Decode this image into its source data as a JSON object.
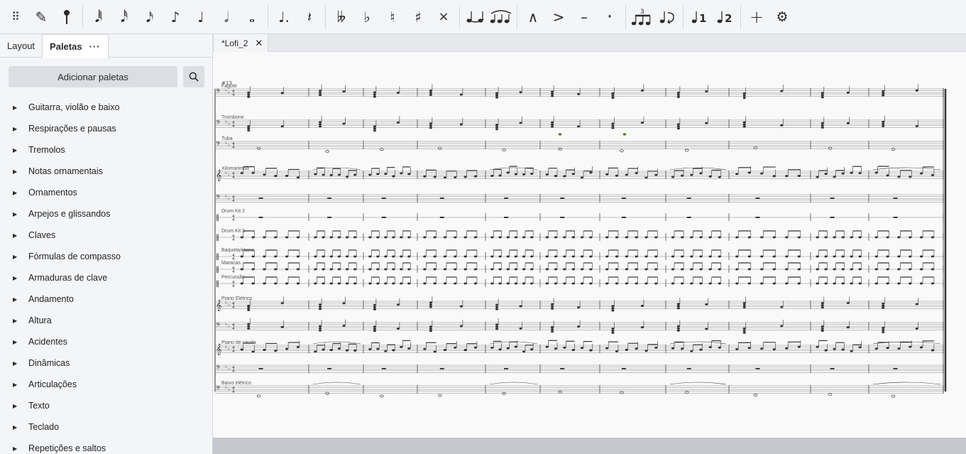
{
  "toolbar": {
    "items": [
      {
        "name": "drag-handle-icon",
        "glyph": "⠿"
      },
      {
        "name": "pencil-icon",
        "glyph": "✎"
      },
      {
        "name": "pin-icon",
        "glyph": "pin"
      },
      {
        "sep": true
      },
      {
        "name": "64th-note-icon",
        "glyph": "𝅘𝅥𝅱"
      },
      {
        "name": "32nd-note-icon",
        "glyph": "𝅘𝅥𝅰"
      },
      {
        "name": "16th-note-icon",
        "glyph": "𝅘𝅥𝅯"
      },
      {
        "name": "eighth-note-icon",
        "glyph": "♪"
      },
      {
        "name": "quarter-note-icon",
        "glyph": "♩"
      },
      {
        "name": "half-note-icon",
        "glyph": "𝅗𝅥"
      },
      {
        "name": "whole-note-icon",
        "glyph": "𝅝"
      },
      {
        "sep": true
      },
      {
        "name": "augmentation-dot-icon",
        "glyph": "♩."
      },
      {
        "name": "rest-icon",
        "glyph": "𝄽"
      },
      {
        "sep": true
      },
      {
        "name": "double-flat-icon",
        "glyph": "𝄫"
      },
      {
        "name": "flat-icon",
        "glyph": "♭"
      },
      {
        "name": "natural-icon",
        "glyph": "♮"
      },
      {
        "name": "sharp-icon",
        "glyph": "♯"
      },
      {
        "name": "double-sharp-icon",
        "glyph": "×"
      },
      {
        "sep": true
      },
      {
        "name": "tie-icon",
        "glyph": "tie"
      },
      {
        "name": "slur-icon",
        "glyph": "slur"
      },
      {
        "sep": true
      },
      {
        "name": "marcato-icon",
        "glyph": "∧"
      },
      {
        "name": "accent-icon",
        "glyph": ">"
      },
      {
        "name": "tenuto-icon",
        "glyph": "–"
      },
      {
        "name": "staccato-icon",
        "glyph": "·"
      },
      {
        "sep": true
      },
      {
        "name": "tuplet-icon",
        "glyph": "tuplet"
      },
      {
        "name": "flip-direction-icon",
        "glyph": "flip"
      },
      {
        "sep": true
      },
      {
        "name": "voice-1-icon",
        "glyph": "1"
      },
      {
        "name": "voice-2-icon",
        "glyph": "2"
      },
      {
        "sep": true
      },
      {
        "name": "add-icon",
        "glyph": "+"
      },
      {
        "name": "settings-gear-icon",
        "glyph": "⚙"
      }
    ]
  },
  "panel": {
    "tabs": [
      {
        "label": "Layout",
        "active": false
      },
      {
        "label": "Paletas",
        "active": true
      }
    ],
    "more_label": "···",
    "add_button_label": "Adicionar paletas",
    "palettes": [
      "Guitarra, violão e baixo",
      "Respirações e pausas",
      "Tremolos",
      "Notas ornamentais",
      "Ornamentos",
      "Arpejos e glissandos",
      "Claves",
      "Fórmulas de compasso",
      "Armaduras de clave",
      "Andamento",
      "Altura",
      "Acidentes",
      "Dinâmicas",
      "Articulações",
      "Texto",
      "Teclado",
      "Repetições e saltos"
    ]
  },
  "document": {
    "tab_title": "*Lofi_2",
    "measure_number": "#13",
    "instruments": [
      {
        "label": "Fagote",
        "clef": "bass"
      },
      {
        "label": "Trombone",
        "clef": "bass"
      },
      {
        "label": "Tuba",
        "clef": "bass"
      },
      {
        "label": "Xilomarimba",
        "clef": "treble"
      },
      {
        "label": "",
        "clef": "bass"
      },
      {
        "label": "Drum Kit 2",
        "clef": "perc"
      },
      {
        "label": "Drum Kit 3",
        "clef": "perc"
      },
      {
        "label": "Baqueta/etana",
        "clef": "perc"
      },
      {
        "label": "Maracas",
        "clef": "perc"
      },
      {
        "label": "Percussão",
        "clef": "perc"
      },
      {
        "label": "Piano Elétrico",
        "clef": "treble"
      },
      {
        "label": "",
        "clef": "bass"
      },
      {
        "label": "Piano de cauda",
        "clef": "treble"
      },
      {
        "label": "",
        "clef": "bass"
      },
      {
        "label": "Baixo elétrico",
        "clef": "bass"
      }
    ]
  },
  "colors": {
    "accent": "#2b2b2b",
    "panel_bg": "#f4f5f7",
    "score_bg": "#f9f9fa",
    "statusbar": "#c5c8cd",
    "note_green": "#5b7d2a"
  }
}
